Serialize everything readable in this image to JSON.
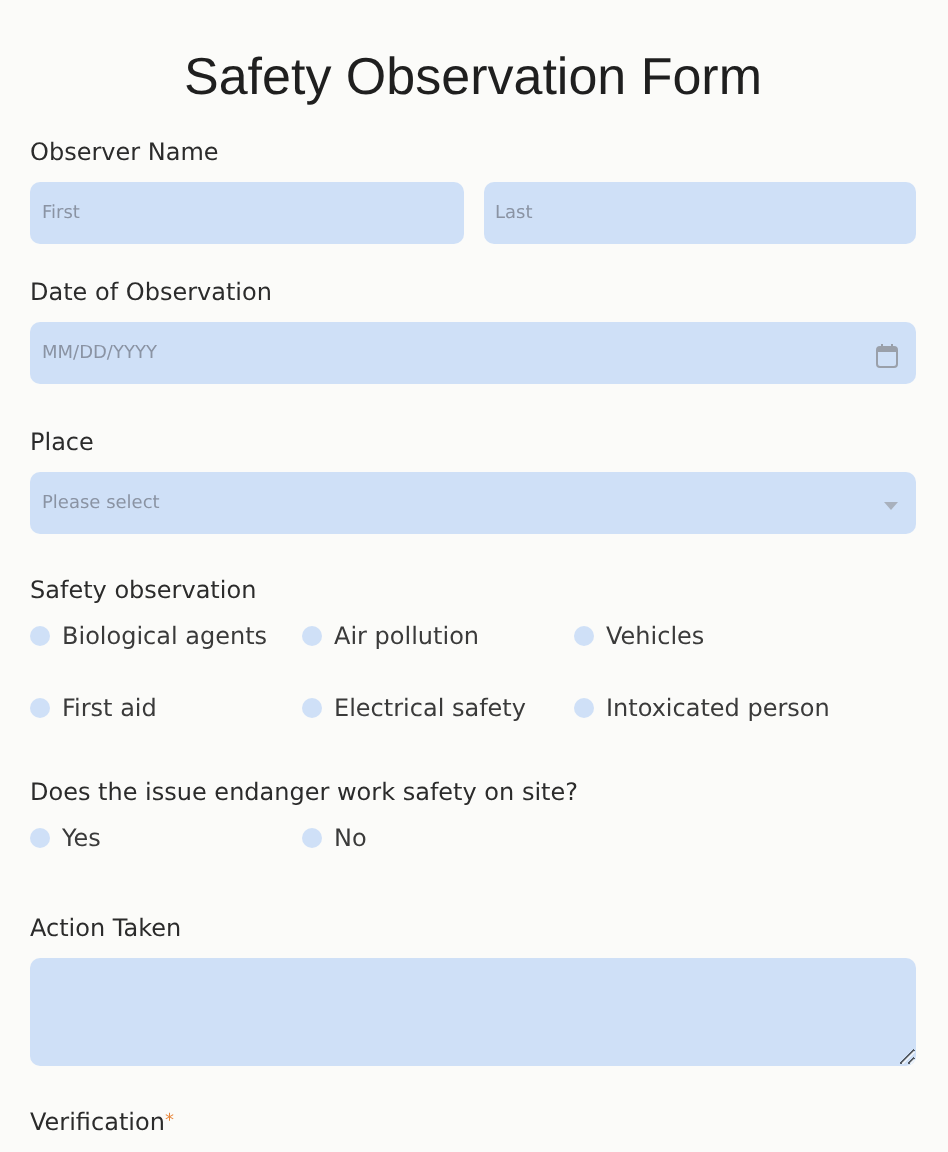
{
  "title": "Safety Observation Form",
  "observer_name": {
    "label": "Observer Name",
    "fields": [
      {
        "placeholder": "First"
      },
      {
        "placeholder": "Last"
      }
    ]
  },
  "date_of_observation": {
    "label": "Date of Observation",
    "placeholder": "MM/DD/YYYY"
  },
  "place": {
    "label": "Place",
    "placeholder": "Please select"
  },
  "safety_observation": {
    "label": "Safety observation",
    "options": [
      {
        "label": "Biological agents",
        "selected": false
      },
      {
        "label": "Air pollution",
        "selected": false
      },
      {
        "label": "Vehicles",
        "selected": false
      },
      {
        "label": "First aid",
        "selected": false
      },
      {
        "label": "Electrical safety",
        "selected": false
      },
      {
        "label": "Intoxicated person",
        "selected": false
      }
    ]
  },
  "endanger_question": {
    "label": "Does the issue endanger work safety on site?",
    "options": [
      {
        "label": "Yes",
        "selected": false
      },
      {
        "label": "No",
        "selected": false
      }
    ]
  },
  "action_taken": {
    "label": "Action Taken"
  },
  "verification": {
    "label": "Verification",
    "required_mark": "*"
  }
}
